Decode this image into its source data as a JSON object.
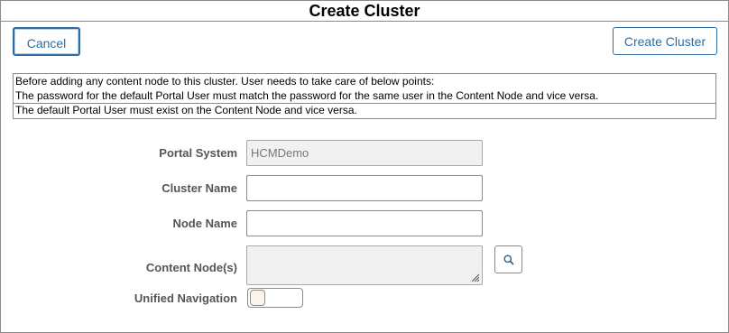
{
  "dialog": {
    "title": "Create Cluster"
  },
  "toolbar": {
    "cancel_label": "Cancel",
    "create_label": "Create Cluster"
  },
  "notice": {
    "lines": [
      "Before adding any content node to this cluster. User needs to take care of below points:",
      "The password for the default Portal User must match the password for the same user in the Content Node and vice versa.",
      "The default Portal User must exist on the Content Node and vice versa."
    ]
  },
  "form": {
    "portal_system": {
      "label": "Portal System",
      "value": "HCMDemo",
      "disabled": true
    },
    "cluster_name": {
      "label": "Cluster Name",
      "value": ""
    },
    "node_name": {
      "label": "Node Name",
      "value": ""
    },
    "content_nodes": {
      "label": "Content Node(s)",
      "value": "",
      "lookup_icon": "search-icon"
    },
    "unified_navigation": {
      "label": "Unified Navigation",
      "on": false
    }
  }
}
